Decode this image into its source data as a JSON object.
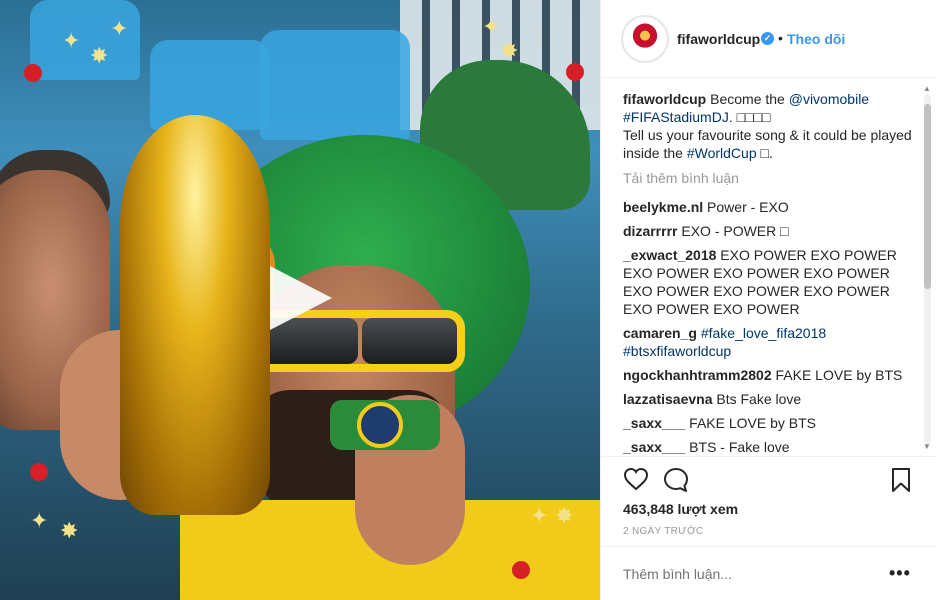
{
  "media": {
    "type": "video",
    "play_icon": "play-icon"
  },
  "header": {
    "username": "fifaworldcup",
    "verified_icon": "verified-badge-icon",
    "separator": "•",
    "follow_label": "Theo dõi"
  },
  "caption": {
    "username": "fifaworldcup",
    "text_1": " Become the ",
    "mention": "@vivomobile",
    "hashtag_1": "#FIFAStadiumDJ",
    "text_2": ". □□□□",
    "text_3": "Tell us your favourite song & it could be played inside the ",
    "hashtag_2": "#WorldCup",
    "text_4": " □."
  },
  "load_more_label": "Tải thêm bình luận",
  "comments": [
    {
      "username": "beelykme.nl",
      "text": " Power - EXO"
    },
    {
      "username": "dizarrrrr",
      "text": " EXO - POWER □"
    },
    {
      "username": "_exwact_2018",
      "text": " EXO POWER EXO POWER EXO POWER EXO POWER EXO POWER EXO POWER EXO POWER EXO POWER EXO POWER EXO POWER"
    },
    {
      "username": "camaren_g",
      "tag1": " #fake_love_fifa2018",
      "tag2": "#btsxfifaworldcup"
    },
    {
      "username": "ngockhanhtramm2802",
      "text": " FAKE LOVE by BTS"
    },
    {
      "username": "lazzatisaevna",
      "text": " Bts Fake love"
    },
    {
      "username": "_saxx___",
      "text": " FAKE LOVE by BTS"
    },
    {
      "username": "_saxx___",
      "text": " BTS - Fake love"
    }
  ],
  "actions": {
    "like_icon": "heart-icon",
    "comment_icon": "comment-icon",
    "save_icon": "bookmark-icon",
    "views": "463,848 lượt xem",
    "timestamp": "2 NGÀY TRƯỚC"
  },
  "comment_box": {
    "placeholder": "Thêm bình luận...",
    "more_label": "•••"
  },
  "colors": {
    "link": "#3897f0",
    "hashtag": "#003569",
    "muted": "#999999"
  }
}
